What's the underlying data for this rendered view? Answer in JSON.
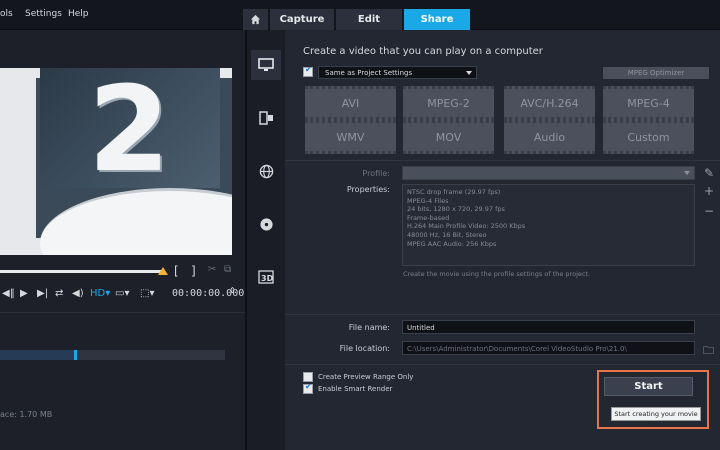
{
  "menu": {
    "file_partial": "ols",
    "settings": "Settings",
    "help": "Help"
  },
  "tabs": {
    "home_icon": "home-icon",
    "capture": "Capture",
    "edit": "Edit",
    "share": "Share"
  },
  "preview": {
    "big_number": "2",
    "bracket_in": "[",
    "bracket_out": "]",
    "timecode": "00:00:00.000",
    "free_space": "ace: 1.70 MB",
    "progress": 0.33
  },
  "share": {
    "heading": "Create a video that you can play on a computer",
    "same_as_project": "Same as Project Settings",
    "mpeg_optimizer": "MPEG Optimizer",
    "formats": [
      "AVI",
      "MPEG-2",
      "AVC/H.264",
      "MPEG-4",
      "WMV",
      "MOV",
      "Audio",
      "Custom"
    ],
    "profile_label": "Profile:",
    "properties_label": "Properties:",
    "properties": [
      "NTSC drop frame (29.97 fps)",
      "MPEG-4 Files",
      "24 bits, 1280 x 720, 29.97 fps",
      "Frame-based",
      "H.264 Main Profile Video: 2500 Kbps",
      "48000 Hz, 16 Bit, Stereo",
      "MPEG AAC Audio: 256 Kbps"
    ],
    "description": "Create the movie using the profile settings of the project.",
    "file_name_label": "File name:",
    "file_name": "Untitled",
    "file_location_label": "File location:",
    "file_location": "C:\\Users\\Administrator\\Documents\\Corel VideoStudio Pro\\21.0\\",
    "preview_range": "Create Preview Range Only",
    "smart_render": "Enable Smart Render",
    "start": "Start",
    "tooltip": "Start creating your movie"
  }
}
